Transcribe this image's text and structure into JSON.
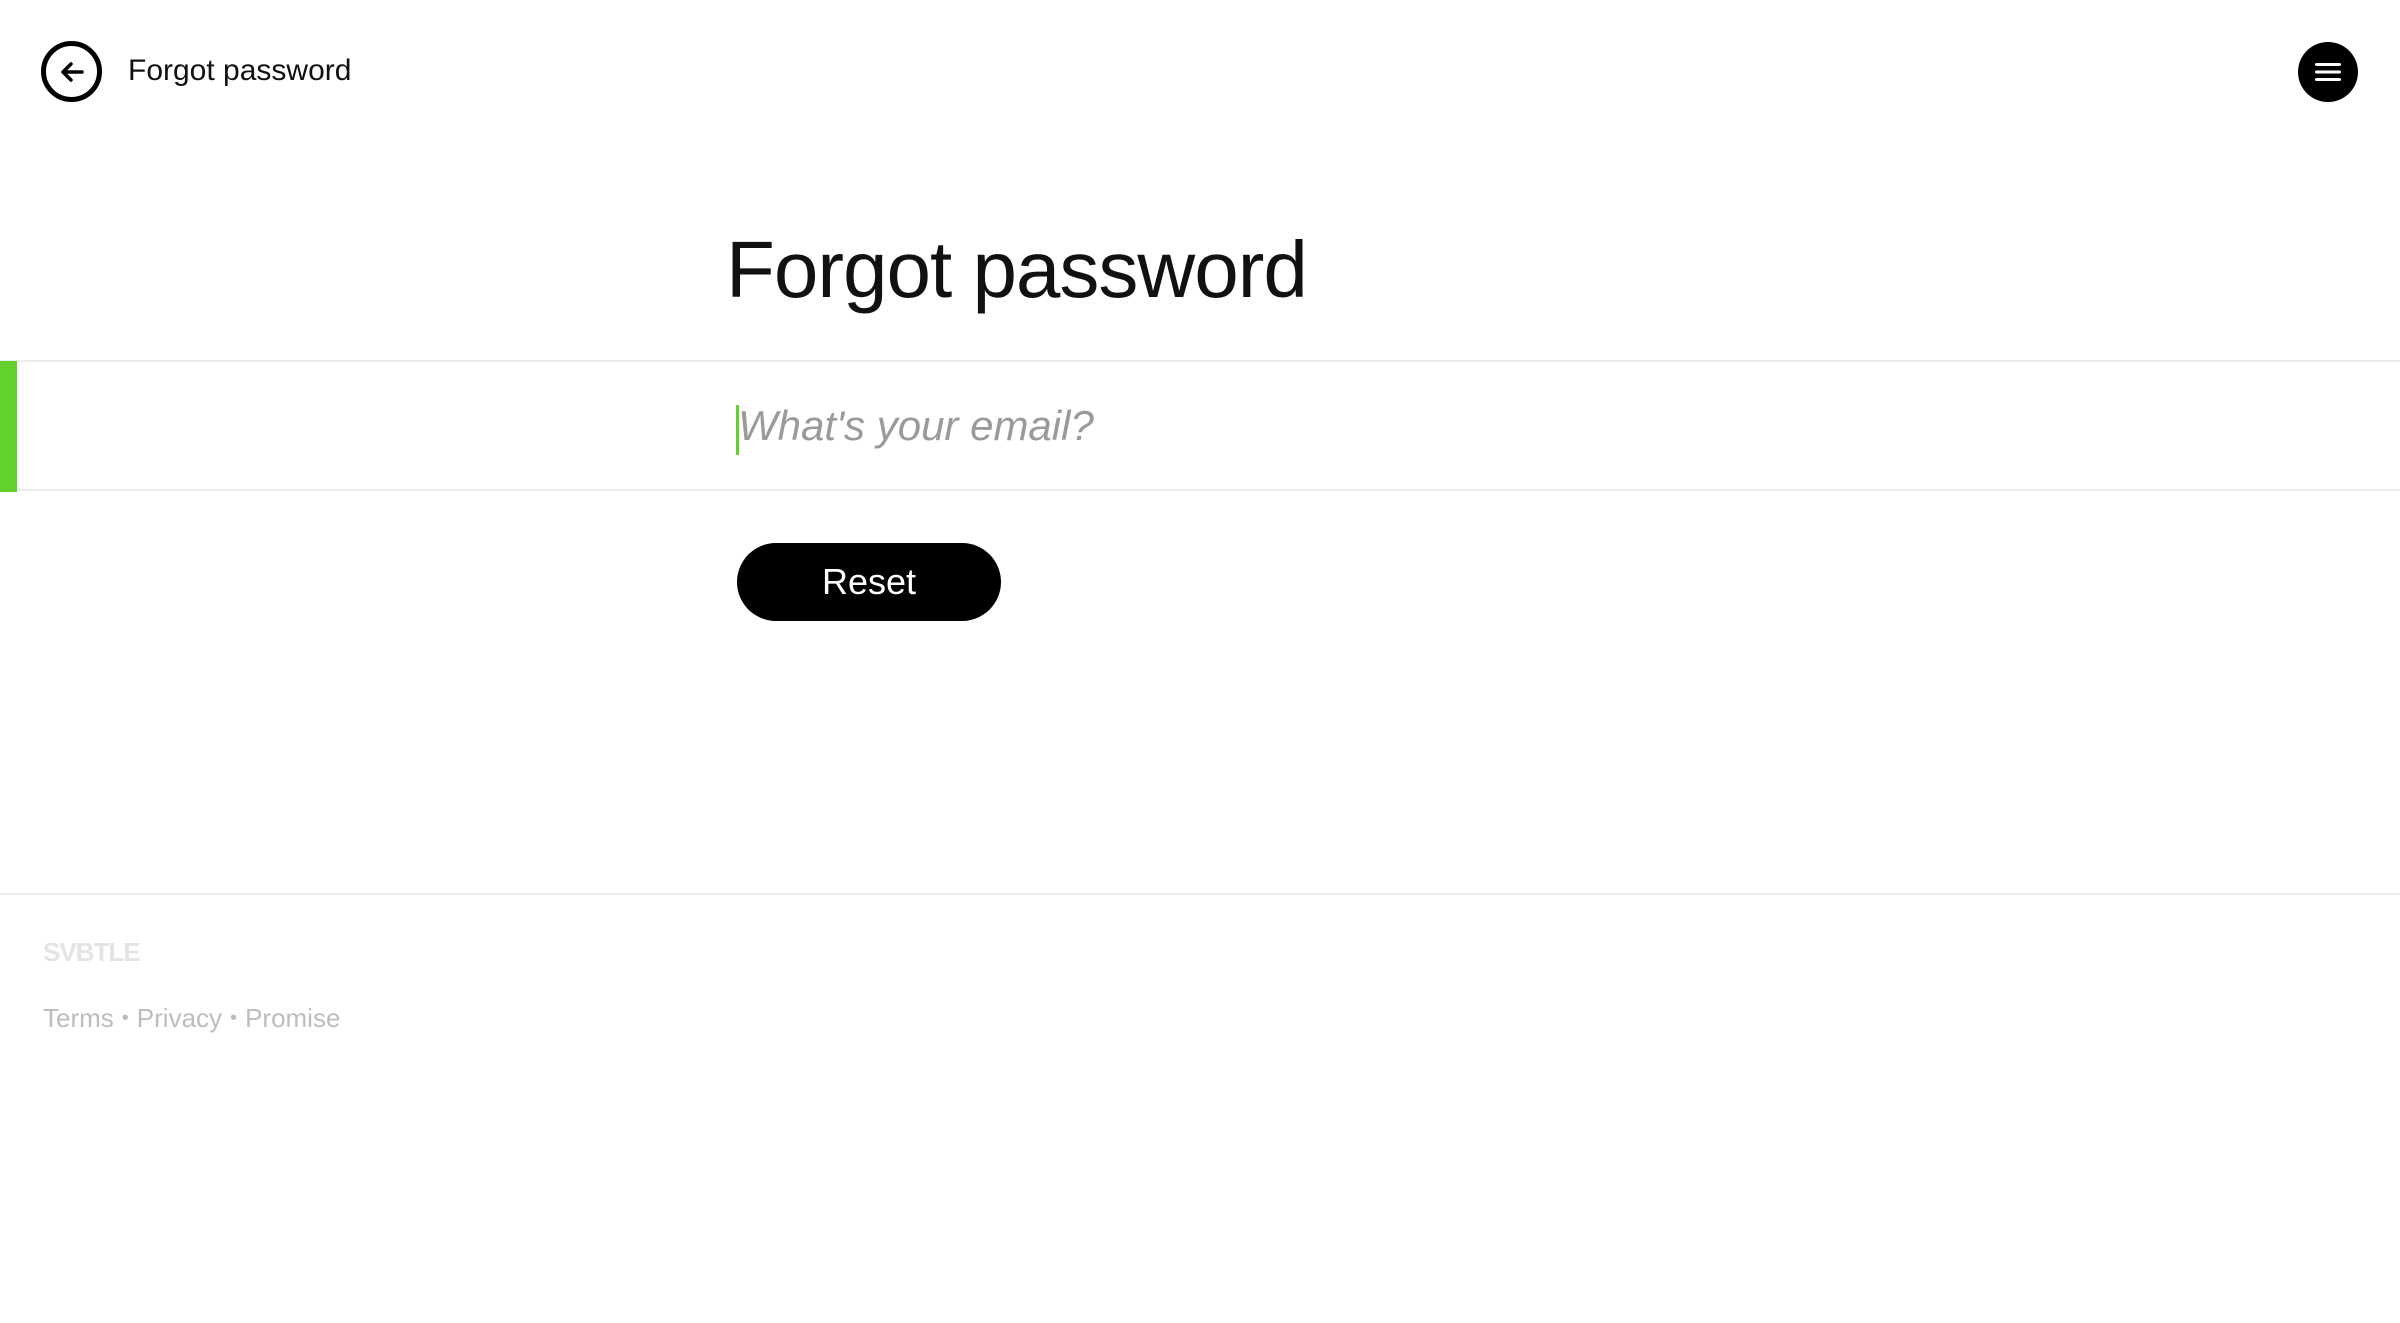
{
  "header": {
    "back_icon": "arrow-left-circle-icon",
    "title": "Forgot password",
    "menu_icon": "hamburger-menu-icon"
  },
  "main": {
    "title": "Forgot password",
    "email_input": {
      "placeholder": "What's your email?",
      "value": ""
    },
    "reset_button_label": "Reset",
    "accent_color": "#62d12d"
  },
  "footer": {
    "logo": "SVBTLE",
    "links": [
      {
        "label": "Terms"
      },
      {
        "label": "Privacy"
      },
      {
        "label": "Promise"
      }
    ],
    "separator": "•"
  }
}
